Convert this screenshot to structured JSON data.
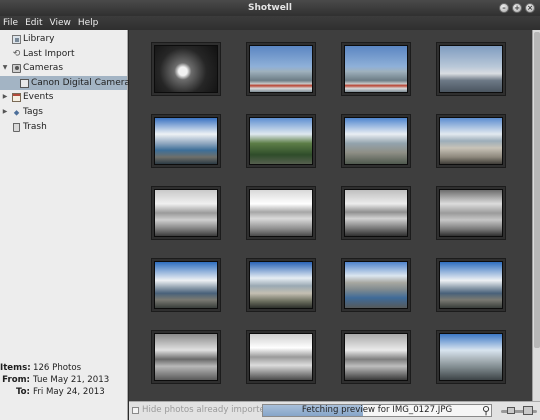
{
  "window": {
    "title": "Shotwell"
  },
  "menu": [
    "File",
    "Edit",
    "View",
    "Help"
  ],
  "sidebar": {
    "items": [
      {
        "label": "Library",
        "icon": "library-icon",
        "arrow": "",
        "indent": 0
      },
      {
        "label": "Last Import",
        "icon": "last-import-icon",
        "arrow": "",
        "indent": 0
      },
      {
        "label": "Cameras",
        "icon": "camera-icon",
        "arrow": "down",
        "indent": 0
      },
      {
        "label": "Canon Digital Camera",
        "icon": "camera-icon",
        "arrow": "",
        "indent": 1,
        "selected": true
      },
      {
        "label": "Events",
        "icon": "events-icon",
        "arrow": "right",
        "indent": 0
      },
      {
        "label": "Tags",
        "icon": "tags-icon",
        "arrow": "right",
        "indent": 0
      },
      {
        "label": "Trash",
        "icon": "trash-icon",
        "arrow": "",
        "indent": 0
      }
    ]
  },
  "info": {
    "items_label": "Items:",
    "items_value": "126 Photos",
    "from_label": "From:",
    "from_value": "Tue May 21, 2013",
    "to_label": "To:",
    "to_value": "Fri May 24, 2013"
  },
  "photos": [
    "dark-bw-lamp",
    "airplane-wing-blue",
    "airplane-wing-blue",
    "harbor-haze",
    "harbor-blue-clouds",
    "trees-green-sky",
    "seaside-promenade",
    "rocky-shore",
    "bw-rocks-sea",
    "bw-rocks-bright",
    "bw-rocky-shore",
    "bw-cloudy-rocks",
    "city-bay-clouds",
    "coast-town-blue-sky",
    "city-bay-blue",
    "city-bay-clouds",
    "bw-clouds-hills",
    "bw-road-sea",
    "bw-town-houses",
    "coast-blue-sky"
  ],
  "bottom": {
    "hide_imported_label": "Hide photos already imported",
    "hide_imported_checked": false,
    "progress_text": "Fetching preview for IMG_0127.JPG",
    "progress_fraction": 0.44
  },
  "colors": {
    "selection": "#a3b4c4",
    "grid_background": "#3e3e3e",
    "progress_fill": "#86a5c9"
  }
}
